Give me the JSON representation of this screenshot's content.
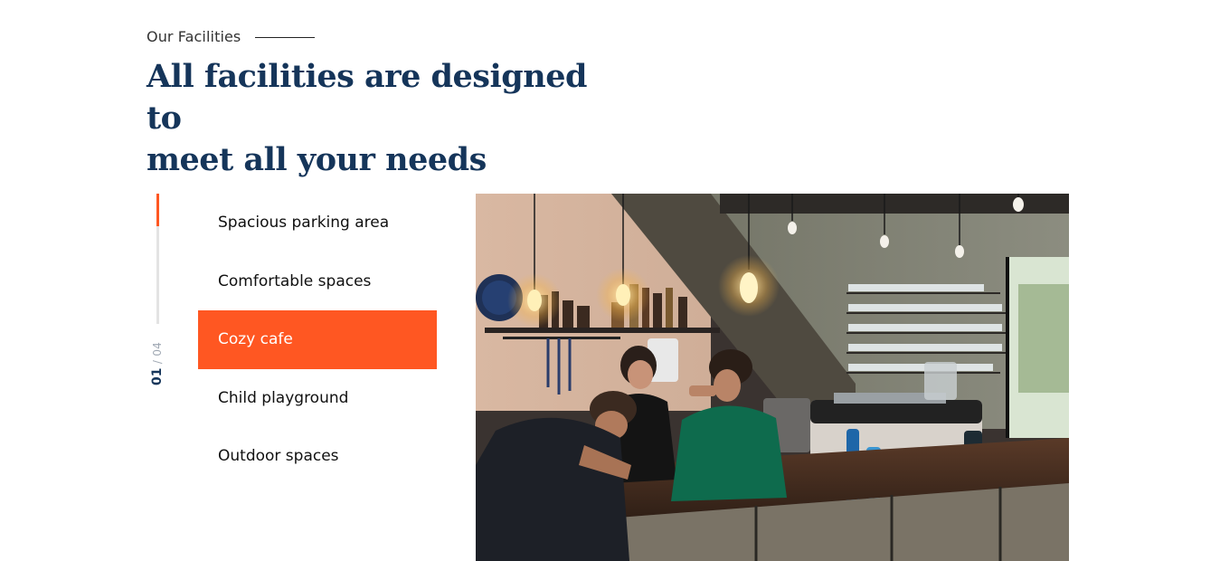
{
  "section": {
    "eyebrow": "Our Facilities",
    "heading_line1": "All facilities are designed to",
    "heading_line2": "meet all your needs"
  },
  "counter": {
    "current": "01",
    "separator": "/",
    "total": "04"
  },
  "progress": {
    "fraction": 0.25
  },
  "facilities": [
    {
      "label": "Spacious parking area",
      "active": false
    },
    {
      "label": "Comfortable spaces",
      "active": false
    },
    {
      "label": "Cozy cafe",
      "active": true
    },
    {
      "label": "Child playground",
      "active": false
    },
    {
      "label": "Outdoor spaces",
      "active": false
    }
  ],
  "colors": {
    "accent": "#ff5722",
    "heading": "#15355a",
    "track": "#e3e3e3"
  },
  "image": {
    "subject": "cafe-interior-photo"
  }
}
